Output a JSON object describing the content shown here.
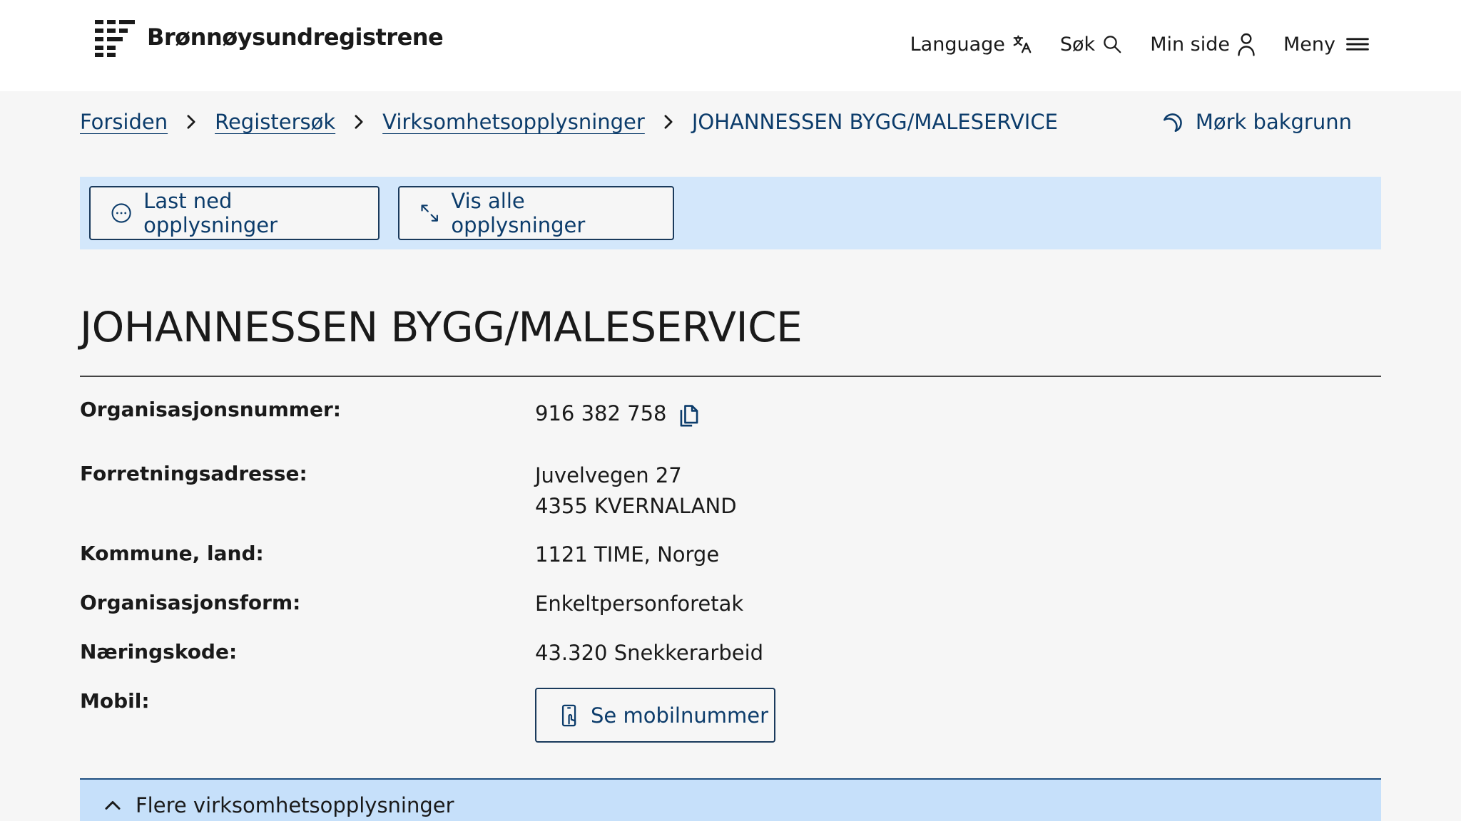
{
  "header": {
    "brand": "Brønnøysundregistrene",
    "nav": {
      "language": "Language",
      "search": "Søk",
      "my_page": "Min side",
      "menu": "Meny"
    }
  },
  "breadcrumb": {
    "items": [
      "Forsiden",
      "Registersøk",
      "Virksomhetsopplysninger"
    ],
    "current": "JOHANNESSEN BYGG/MALESERVICE"
  },
  "dark_mode_label": "Mørk bakgrunn",
  "actions": {
    "download": "Last ned opplysninger",
    "show_all": "Vis alle opplysninger"
  },
  "company": {
    "name": "JOHANNESSEN BYGG/MALESERVICE",
    "fields": {
      "org_number": {
        "label": "Organisasjonsnummer:",
        "value": "916 382 758"
      },
      "address": {
        "label": "Forretningsadresse:",
        "line1": "Juvelvegen 27",
        "line2": "4355 KVERNALAND"
      },
      "municipality": {
        "label": "Kommune, land:",
        "value": "1121 TIME, Norge"
      },
      "org_form": {
        "label": "Organisasjonsform:",
        "value": "Enkeltpersonforetak"
      },
      "industry_code": {
        "label": "Næringskode:",
        "value": "43.320 Snekkerarbeid"
      },
      "mobile": {
        "label": "Mobil:",
        "button": "Se mobilnummer"
      }
    }
  },
  "accordion": {
    "label": "Flere virksomhetsopplysninger"
  },
  "colors": {
    "link": "#0c3c6b",
    "action_bar_bg": "#d3e7fb",
    "accordion_bg": "#c6e0fa",
    "page_bg": "#f6f6f6"
  }
}
